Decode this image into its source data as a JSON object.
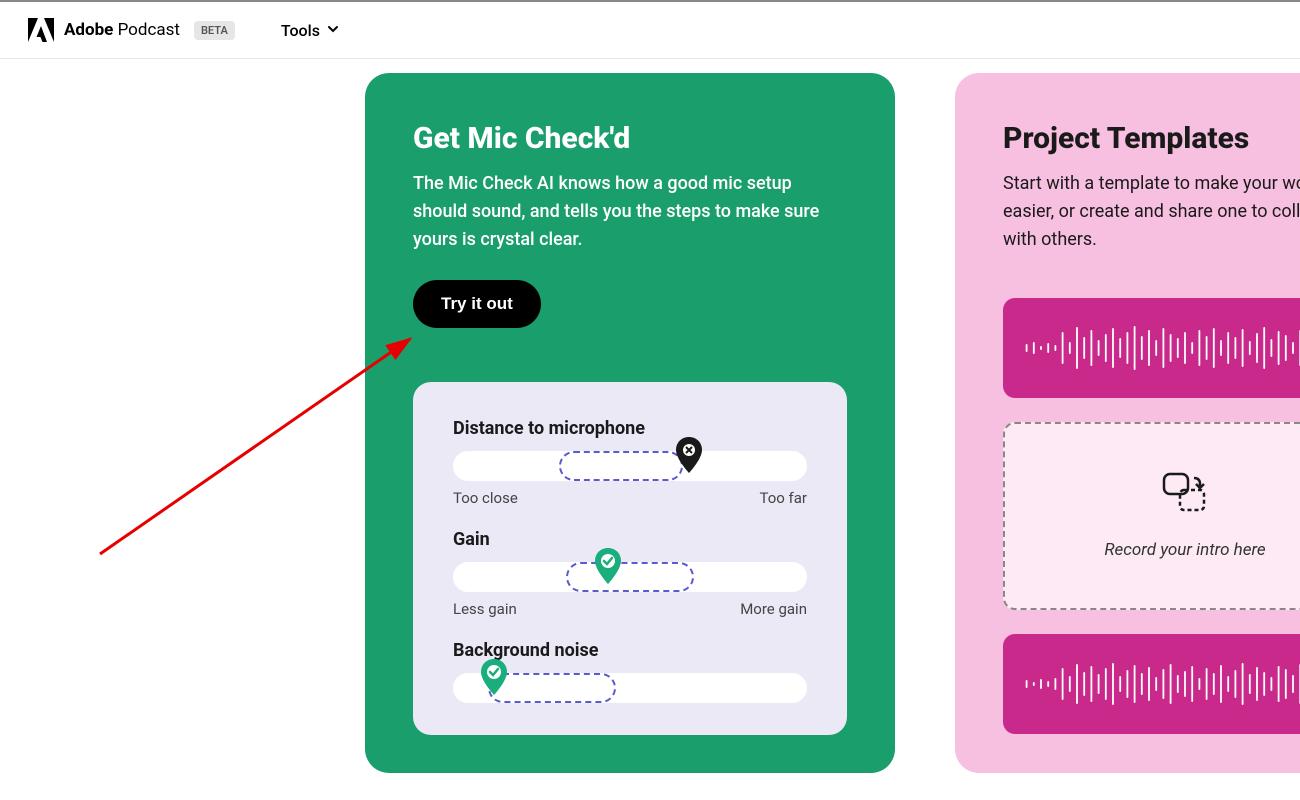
{
  "header": {
    "brand_bold": "Adobe",
    "brand_regular": "Podcast",
    "beta_label": "BETA",
    "tools_label": "Tools"
  },
  "green_card": {
    "title": "Get Mic Check'd",
    "description": "The Mic Check AI knows how a good mic setup should sound, and tells you the steps to make sure yours is crystal clear.",
    "button": "Try it out",
    "sliders": {
      "distance": {
        "label": "Distance to microphone",
        "left": "Too close",
        "right": "Too far"
      },
      "gain": {
        "label": "Gain",
        "left": "Less gain",
        "right": "More gain"
      },
      "noise": {
        "label": "Background noise"
      }
    }
  },
  "pink_card": {
    "title": "Project Templates",
    "description": "Start with a template to make your workflow easier, or create and share one to collaborate with others.",
    "placeholder_text": "Record your intro here"
  }
}
